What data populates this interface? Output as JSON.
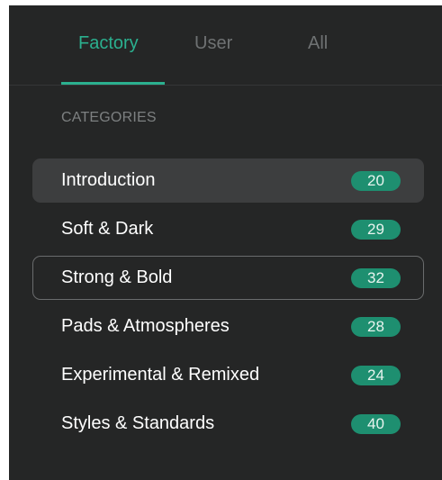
{
  "tabs": [
    {
      "label": "Factory",
      "active": true
    },
    {
      "label": "User",
      "active": false
    },
    {
      "label": "All",
      "active": false
    }
  ],
  "section_label": "CATEGORIES",
  "categories": [
    {
      "label": "Introduction",
      "count": "20",
      "state": "selected"
    },
    {
      "label": "Soft & Dark",
      "count": "29",
      "state": "normal"
    },
    {
      "label": "Strong & Bold",
      "count": "32",
      "state": "focused"
    },
    {
      "label": "Pads & Atmospheres",
      "count": "28",
      "state": "normal"
    },
    {
      "label": "Experimental & Remixed",
      "count": "24",
      "state": "normal"
    },
    {
      "label": "Styles & Standards",
      "count": "40",
      "state": "normal"
    }
  ],
  "colors": {
    "background": "#252626",
    "accent": "#2bb08f",
    "badge": "#1e8f70",
    "selected_row": "#3d3e3f",
    "inactive_tab": "#6f7273"
  }
}
